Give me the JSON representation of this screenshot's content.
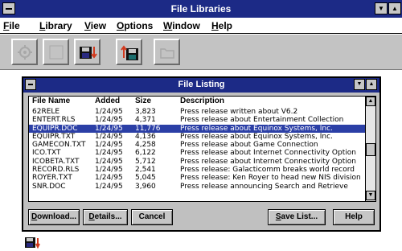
{
  "app": {
    "title": "File Libraries"
  },
  "menu": [
    {
      "label_first": "F",
      "label_rest": "ile"
    },
    {
      "label_first": "L",
      "label_rest": "ibrary"
    },
    {
      "label_first": "V",
      "label_rest": "iew"
    },
    {
      "label_first": "O",
      "label_rest": "ptions"
    },
    {
      "label_first": "W",
      "label_rest": "indow"
    },
    {
      "label_first": "H",
      "label_rest": "elp"
    }
  ],
  "toolbar": {
    "buttons": [
      "gear-disabled-icon",
      "blank-disabled-icon",
      "download-disk-icon",
      "upload-disk-icon",
      "folder-disabled-icon"
    ]
  },
  "listing": {
    "title": "File Listing",
    "headers": {
      "name": "File Name",
      "added": "Added",
      "size": "Size",
      "description": "Description"
    },
    "files": [
      {
        "name": "62RELE",
        "added": "1/24/95",
        "size": "3,823",
        "description": "Press release written about V6.2"
      },
      {
        "name": "ENTERT.RLS",
        "added": "1/24/95",
        "size": "4,371",
        "description": "Press release about Entertainment Collection"
      },
      {
        "name": "EQUIPR.DOC",
        "added": "1/24/95",
        "size": "11,776",
        "description": "Press release about Equinox Systems, Inc."
      },
      {
        "name": "EQUIPR.TXT",
        "added": "1/24/95",
        "size": "4,136",
        "description": "Press release about Equinox Systems, Inc."
      },
      {
        "name": "GAMECON.TXT",
        "added": "1/24/95",
        "size": "4,258",
        "description": "Press release about Game Connection"
      },
      {
        "name": "ICO.TXT",
        "added": "1/24/95",
        "size": "6,122",
        "description": "Press release about Internet Connectivity Option"
      },
      {
        "name": "ICOBETA.TXT",
        "added": "1/24/95",
        "size": "5,712",
        "description": "Press release about Internet Connectivity Option"
      },
      {
        "name": "RECORD.RLS",
        "added": "1/24/95",
        "size": "2,541",
        "description": "Press release:  Galacticomm breaks world record"
      },
      {
        "name": "ROYER.TXT",
        "added": "1/24/95",
        "size": "5,045",
        "description": "Press release: Ken Royer to head new NIS division"
      },
      {
        "name": "SNR.DOC",
        "added": "1/24/95",
        "size": "3,960",
        "description": "Press release announcing Search and Retrieve"
      }
    ],
    "selected_index": 2
  },
  "buttons": {
    "download": {
      "first": "D",
      "rest": "ownload..."
    },
    "details": {
      "first": "D",
      "rest": "etails..."
    },
    "cancel": {
      "first": "",
      "rest": "Cancel"
    },
    "save_list": {
      "first": "S",
      "rest": "ave List..."
    },
    "help": {
      "first": "",
      "rest": "Help"
    }
  },
  "colors": {
    "titlebar": "#1c2a86",
    "selection": "#2b3fa6",
    "face": "#c6c6c6"
  }
}
